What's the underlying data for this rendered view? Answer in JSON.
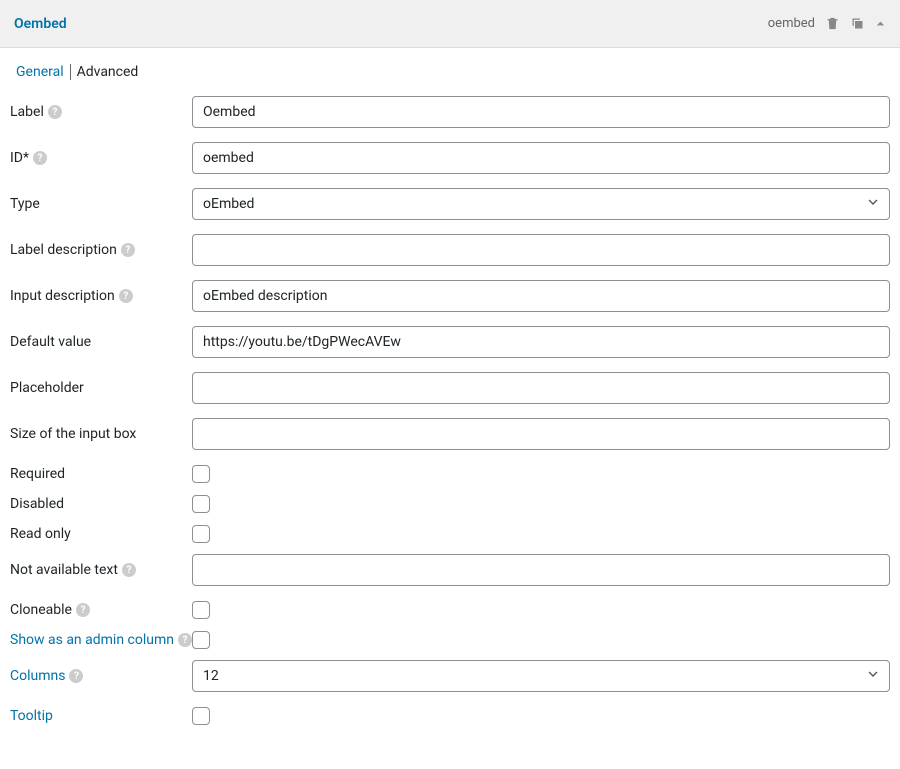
{
  "header": {
    "title": "Oembed",
    "type_label": "oembed"
  },
  "tabs": {
    "general": "General",
    "advanced": "Advanced"
  },
  "fields": {
    "label": {
      "text": "Label",
      "value": "Oembed"
    },
    "id": {
      "text": "ID",
      "value": "oembed"
    },
    "type": {
      "text": "Type",
      "value": "oEmbed"
    },
    "label_desc": {
      "text": "Label description",
      "value": ""
    },
    "input_desc": {
      "text": "Input description",
      "value": "oEmbed description"
    },
    "default_value": {
      "text": "Default value",
      "value": "https://youtu.be/tDgPWecAVEw"
    },
    "placeholder": {
      "text": "Placeholder",
      "value": ""
    },
    "size": {
      "text": "Size of the input box",
      "value": ""
    },
    "required": {
      "text": "Required"
    },
    "disabled": {
      "text": "Disabled"
    },
    "readonly": {
      "text": "Read only"
    },
    "not_available": {
      "text": "Not available text",
      "value": ""
    },
    "cloneable": {
      "text": "Cloneable"
    },
    "admin_column": {
      "text": "Show as an admin column"
    },
    "columns": {
      "text": "Columns",
      "value": "12"
    },
    "tooltip": {
      "text": "Tooltip"
    }
  }
}
